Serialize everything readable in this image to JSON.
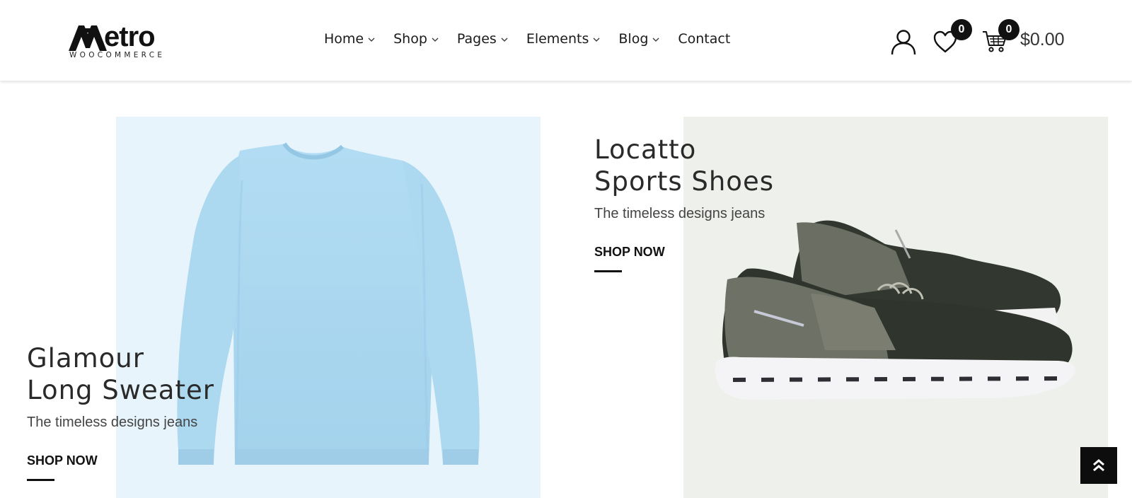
{
  "logo": {
    "text": "etro",
    "subtitle": "WOOCOMMERCE"
  },
  "nav": [
    {
      "label": "Home",
      "has_dropdown": true
    },
    {
      "label": "Shop",
      "has_dropdown": true
    },
    {
      "label": "Pages",
      "has_dropdown": true
    },
    {
      "label": "Elements",
      "has_dropdown": true
    },
    {
      "label": "Blog",
      "has_dropdown": true
    },
    {
      "label": "Contact",
      "has_dropdown": false
    }
  ],
  "header_actions": {
    "user_icon": "user-icon",
    "wishlist_icon": "heart-icon",
    "wishlist_count": "0",
    "cart_icon": "cart-icon",
    "cart_count": "0",
    "cart_total": "$0.00"
  },
  "banners": [
    {
      "title_line1": "Glamour",
      "title_line2": "Long Sweater",
      "subtitle": "The timeless designs jeans",
      "cta": "SHOP NOW",
      "image": "light-blue-sweater",
      "bg_color": "#e8f4fb"
    },
    {
      "title_line1": "Locatto",
      "title_line2": "Sports Shoes",
      "subtitle": "The timeless designs jeans",
      "cta": "SHOP NOW",
      "image": "olive-sneakers",
      "bg_color": "#eef0ec"
    }
  ],
  "back_to_top_icon": "double-chevron-up-icon",
  "colors": {
    "accent": "#111111",
    "sweater": "#a9d6ef",
    "shoe": "#5b5e50"
  }
}
